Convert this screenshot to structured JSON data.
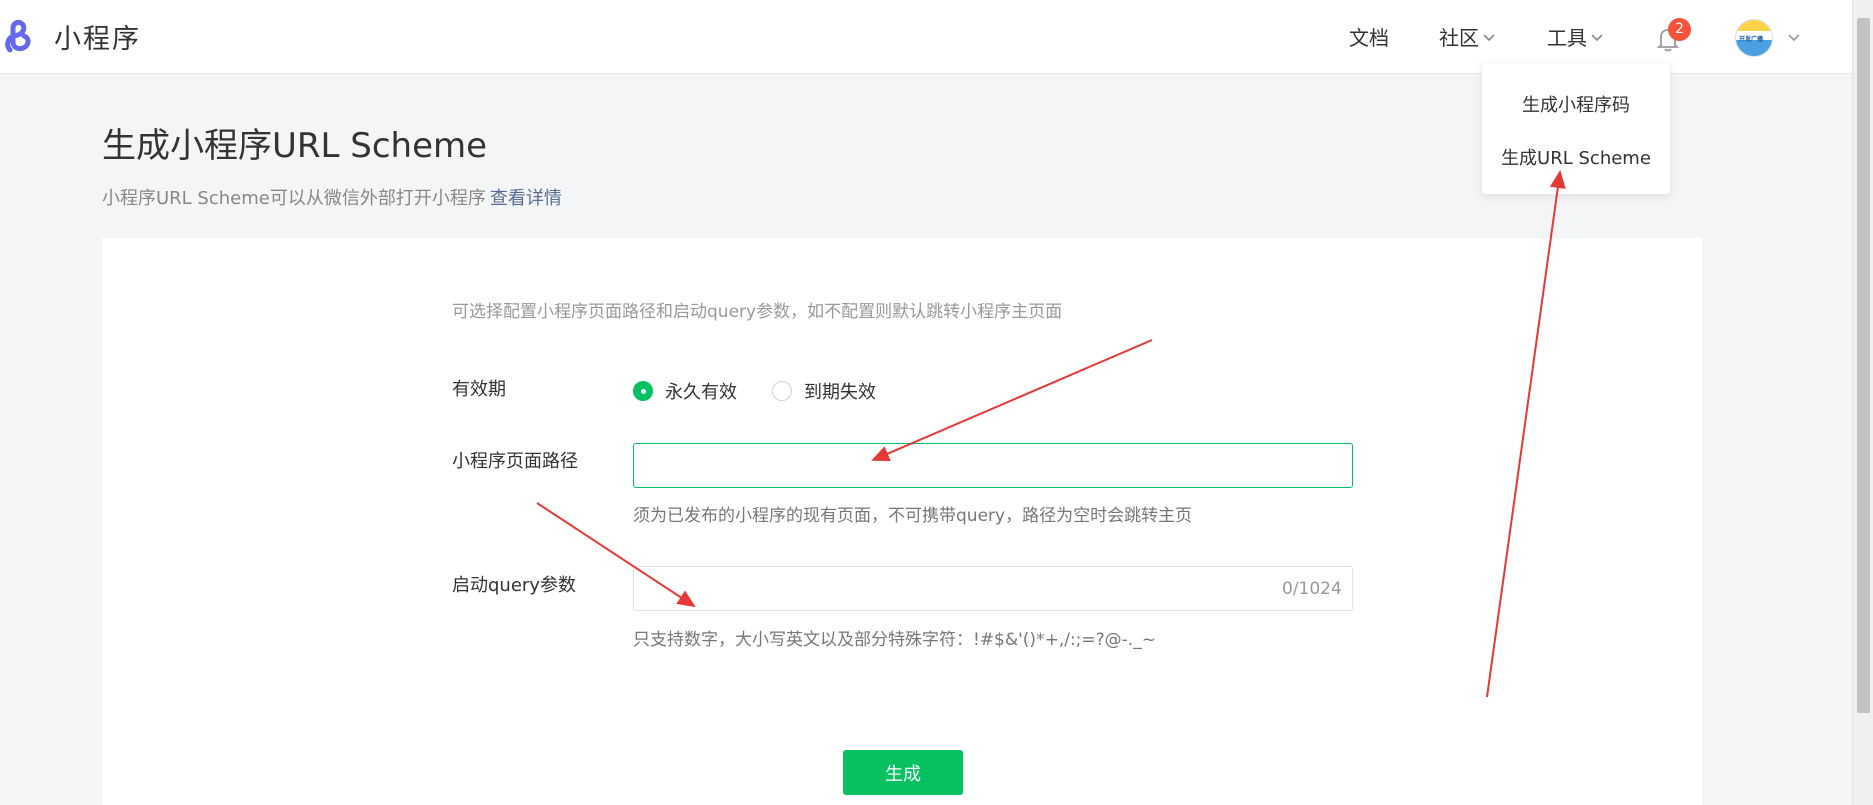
{
  "header": {
    "app_name": "小程序",
    "nav": {
      "docs": "文档",
      "community": "社区",
      "tools": "工具"
    },
    "notification_count": "2",
    "avatar_text": "开发广播"
  },
  "tools_menu": {
    "items": [
      "生成小程序码",
      "生成URL Scheme"
    ]
  },
  "page": {
    "title": "生成小程序URL Scheme",
    "subtitle": "小程序URL Scheme可以从微信外部打开小程序",
    "details_link": "查看详情"
  },
  "form": {
    "hint": "可选择配置小程序页面路径和启动query参数，如不配置则默认跳转小程序主页面",
    "validity": {
      "label": "有效期",
      "options": [
        "永久有效",
        "到期失效"
      ],
      "selected": "永久有效"
    },
    "path": {
      "label": "小程序页面路径",
      "value": "",
      "description": "须为已发布的小程序的现有页面，不可携带query，路径为空时会跳转主页"
    },
    "query": {
      "label": "启动query参数",
      "value": "",
      "counter": "0/1024",
      "description": "只支持数字，大小写英文以及部分特殊字符：!#$&'()*+,/:;=?@-._~"
    },
    "submit_label": "生成"
  },
  "colors": {
    "brand_green": "#07c160",
    "link": "#576b95",
    "badge": "#f5533b",
    "annotation_arrow": "#e53935",
    "logo": "#6467f0"
  }
}
